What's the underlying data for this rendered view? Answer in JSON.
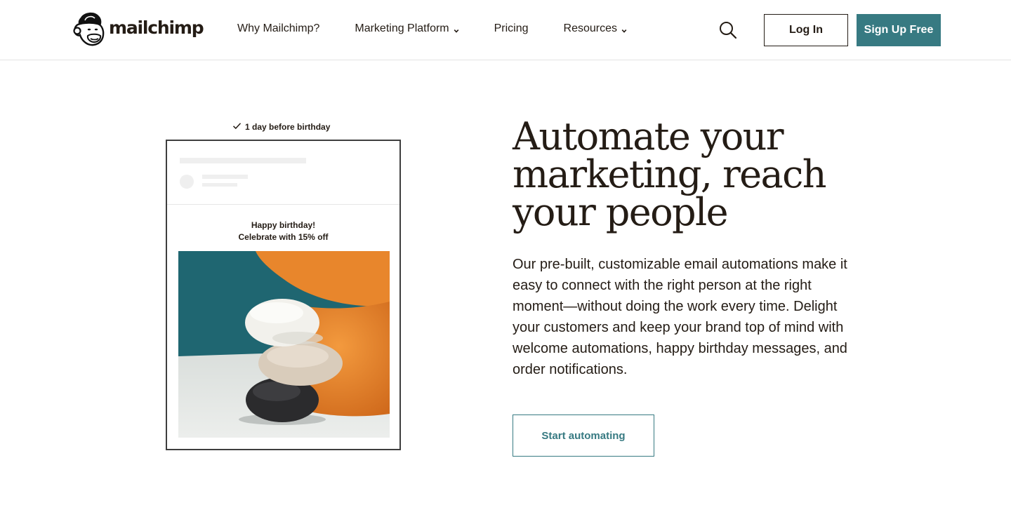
{
  "header": {
    "logo_text": "mailchimp",
    "nav": [
      {
        "label": "Why Mailchimp?",
        "has_dropdown": false
      },
      {
        "label": "Marketing Platform",
        "has_dropdown": true
      },
      {
        "label": "Pricing",
        "has_dropdown": false
      },
      {
        "label": "Resources",
        "has_dropdown": true
      }
    ],
    "login_label": "Log In",
    "signup_label": "Sign Up Free"
  },
  "illustration": {
    "trigger_label": "1 day before birthday",
    "email_heading_line1": "Happy birthday!",
    "email_heading_line2": "Celebrate with 15% off"
  },
  "hero": {
    "headline_line1": "Automate your",
    "headline_line2": "marketing, reach",
    "headline_line3": "your people",
    "body_line1": "Our pre-built, customizable email automations make it",
    "body_line2": "easy to connect with the right person at the right",
    "body_line3": "moment—without doing the work every time. Delight",
    "body_line4": "your customers and keep your brand top of mind with",
    "body_line5": "welcome automations, happy birthday messages, and",
    "body_line6": "order notifications.",
    "cta_label": "Start automating"
  },
  "colors": {
    "brand_teal": "#377a82",
    "text_dark": "#241c15",
    "photo_teal": "#1f6671",
    "photo_orange": "#e07a28"
  },
  "icons": {
    "search": "search-icon",
    "dropdown": "chevron-down-icon",
    "check": "check-icon",
    "logo": "freddie-monkey-logo-icon"
  }
}
